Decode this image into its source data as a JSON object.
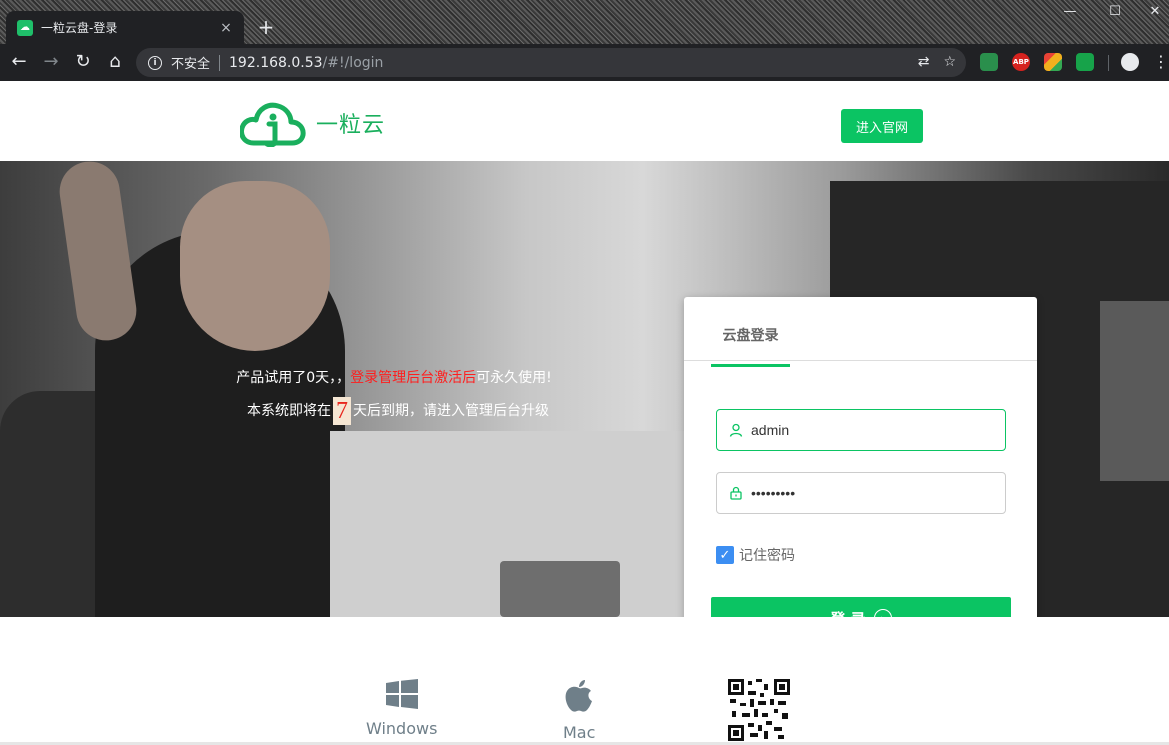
{
  "browser": {
    "tab_title": "一粒云盘-登录",
    "tab_close": "×",
    "new_tab": "+",
    "window_controls": [
      "—",
      "☐",
      "✕"
    ],
    "insecure_label": "不安全",
    "url_host": "192.168.0.53",
    "url_path": "/#!/login",
    "extensions": [
      {
        "name": "globe-extension-icon",
        "color": "#2a8f4c",
        "label": ""
      },
      {
        "name": "adblock-plus-icon",
        "color": "#d6231f",
        "label": "ABP"
      },
      {
        "name": "colorful-extension-icon",
        "color": "#f2b01e",
        "label": ""
      },
      {
        "name": "evernote-icon",
        "color": "#17a34a",
        "label": ""
      }
    ]
  },
  "header": {
    "logo_text": "一粒云",
    "official_button": "进入官网",
    "brand_color": "#0bc463"
  },
  "notice": {
    "line1_prefix": "产品试用了0天，，",
    "line1_red": "登录管理后台激活后",
    "line1_suffix": "可永久使用!",
    "line2_prefix": "本系统即将在",
    "days": "7",
    "line2_suffix": "天后到期，请进入管理后台升级"
  },
  "login": {
    "tab_label": "云盘登录",
    "username": "admin",
    "password": "•••••••••",
    "remember_label": "记住密码",
    "remember_checked": true,
    "submit_label": "登 录"
  },
  "downloads": {
    "windows_label": "Windows",
    "mac_label": "Mac"
  }
}
